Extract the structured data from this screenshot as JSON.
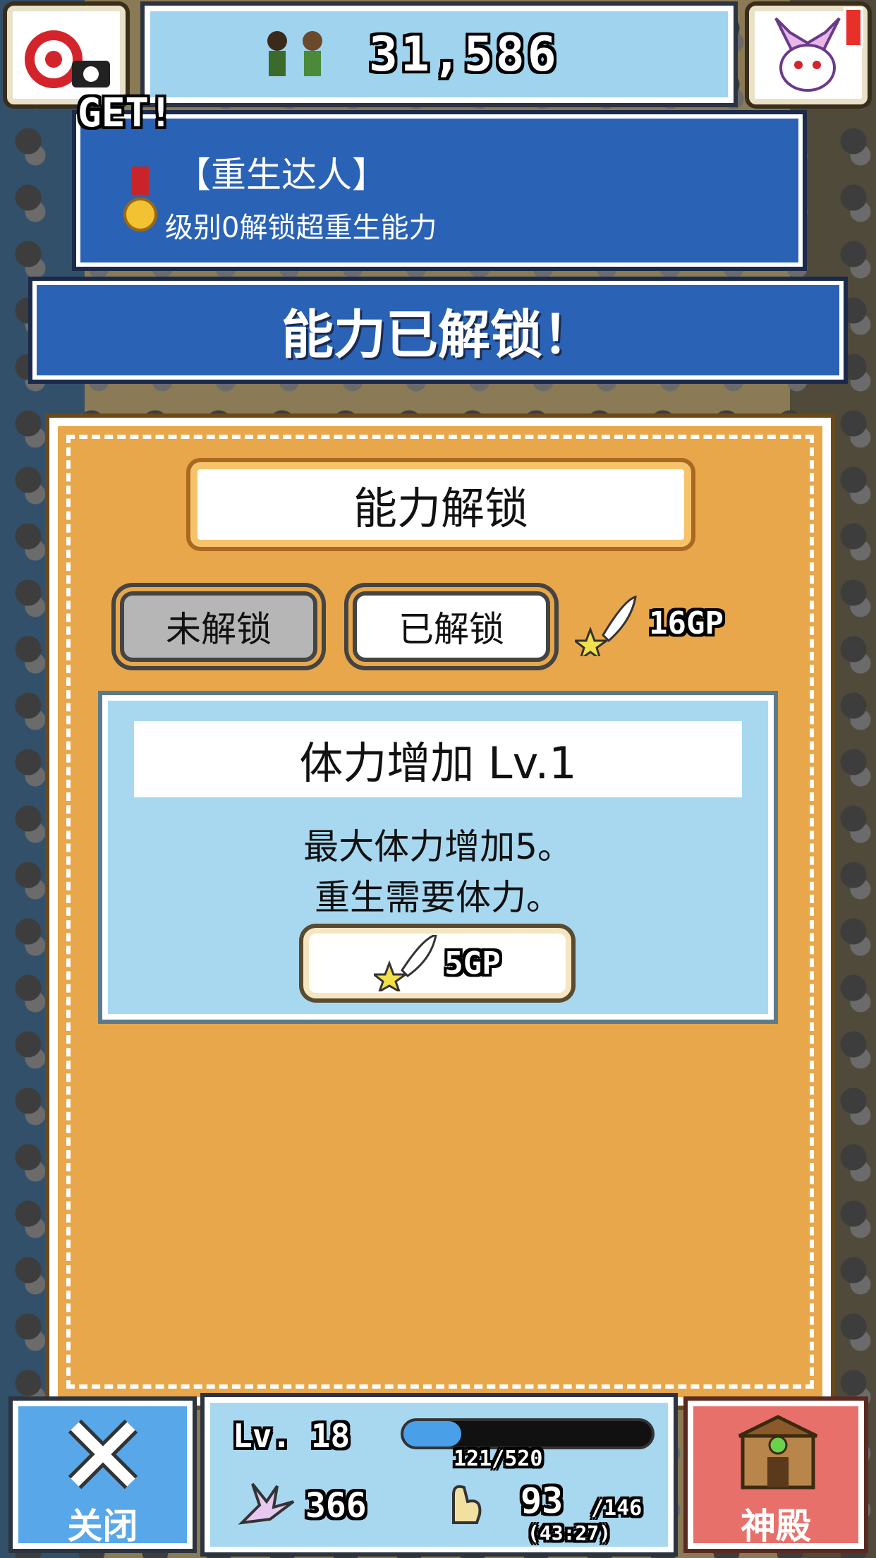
{
  "header": {
    "score": "31,586"
  },
  "achievement": {
    "get_label": "GET!",
    "title": "【重生达人】",
    "description": "级别0解锁超重生能力"
  },
  "notice": {
    "text": "能力已解锁！"
  },
  "panel": {
    "title": "能力解锁",
    "tabs": {
      "locked": "未解锁",
      "unlocked": "已解锁"
    },
    "gp_total": "16GP",
    "card": {
      "name": "体力增加 Lv.1",
      "desc_line1": "最大体力增加5。",
      "desc_line2": "重生需要体力。",
      "cost": "5GP"
    }
  },
  "bottom": {
    "close_label": "关闭",
    "temple_label": "神殿",
    "level": "Lv. 18",
    "exp": "121/520",
    "exp_fraction": 0.233,
    "attack": "366",
    "stamina_current": "93",
    "stamina_max": "/146",
    "timer": "(43:27)"
  },
  "colors": {
    "panel_orange": "#e8a74a",
    "banner_blue": "#2a62b5",
    "card_blue": "#a8d8f0",
    "close_blue": "#58a7e8",
    "temple_red": "#e8706a"
  }
}
